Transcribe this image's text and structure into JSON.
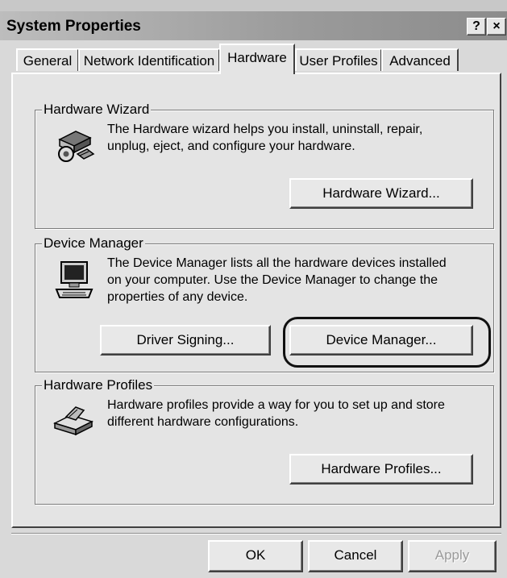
{
  "window": {
    "title": "System Properties",
    "help_label": "?",
    "close_label": "×"
  },
  "tabs": [
    {
      "label": "General"
    },
    {
      "label": "Network Identification"
    },
    {
      "label": "Hardware",
      "active": true
    },
    {
      "label": "User Profiles"
    },
    {
      "label": "Advanced"
    }
  ],
  "hardware_wizard": {
    "legend": "Hardware Wizard",
    "desc_line1": "The Hardware wizard helps you install, uninstall, repair,",
    "desc_line2": "unplug, eject, and configure your hardware.",
    "button": "Hardware Wizard...",
    "icon": "hardware-wizard-icon"
  },
  "device_manager": {
    "legend": "Device Manager",
    "desc_line1": "The Device Manager lists all the hardware devices installed",
    "desc_line2": "on your computer. Use the Device Manager to change the",
    "desc_line3": "properties of any device.",
    "driver_signing_button": "Driver Signing...",
    "device_manager_button": "Device Manager...",
    "icon": "computer-icon"
  },
  "hardware_profiles": {
    "legend": "Hardware Profiles",
    "desc_line1": "Hardware profiles provide a way for you to set up and store",
    "desc_line2": "different hardware configurations.",
    "button": "Hardware Profiles...",
    "icon": "hardware-profiles-icon"
  },
  "footer": {
    "ok": "OK",
    "cancel": "Cancel",
    "apply": "Apply"
  }
}
